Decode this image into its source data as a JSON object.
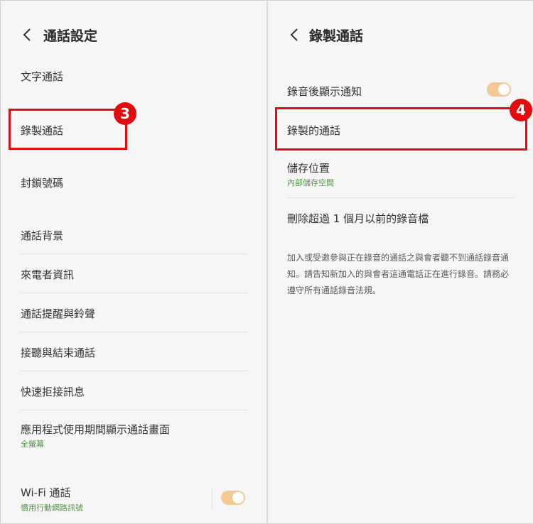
{
  "left": {
    "title": "通話設定",
    "items": [
      {
        "label": "文字通話"
      },
      {
        "label": "錄製通話"
      },
      {
        "label": "封鎖號碼"
      },
      {
        "label": "通話背景"
      },
      {
        "label": "來電者資訊"
      },
      {
        "label": "通話提醒與鈴聲"
      },
      {
        "label": "接聽與結束通話"
      },
      {
        "label": "快速拒接訊息"
      },
      {
        "label": "應用程式使用期間顯示通話畫面",
        "sub": "全螢幕"
      },
      {
        "label": "Wi-Fi 通話",
        "sub": "慣用行動網路訊號",
        "toggle": true
      }
    ],
    "badge": "3"
  },
  "right": {
    "title": "錄製通話",
    "items": [
      {
        "label": "錄音後顯示通知",
        "toggle": true
      },
      {
        "label": "錄製的通話"
      },
      {
        "label": "儲存位置",
        "sub": "內部儲存空間"
      },
      {
        "label": "刪除超過 1 個月以前的錄音檔"
      }
    ],
    "note": "加入或受邀參與正在錄音的通話之與會者聽不到通話錄音通知。請告知新加入的與會者這通電話正在進行錄音。請務必遵守所有通話錄音法規。",
    "badge": "4"
  },
  "colors": {
    "accent_toggle": "#f2c992",
    "highlight": "#e00e12",
    "sub_text": "#4f9a3c"
  },
  "icons": {
    "back": "chevron-left-icon"
  }
}
